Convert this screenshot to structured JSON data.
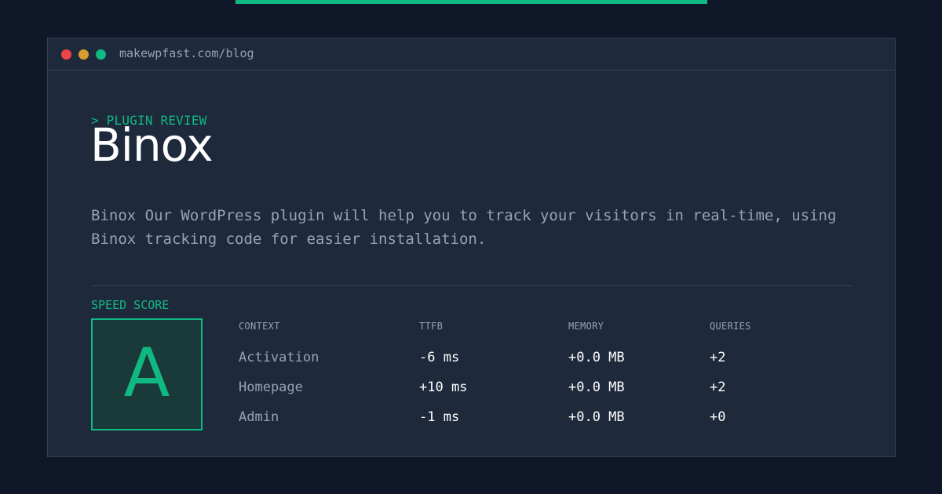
{
  "browser": {
    "url": "makewpfast.com/blog"
  },
  "post": {
    "eyebrow": "> PLUGIN REVIEW",
    "title": "Binox",
    "description": "Binox Our WordPress plugin will help you to track your visitors in real-time, using Binox tracking code for easier installation."
  },
  "speed": {
    "label": "SPEED SCORE",
    "grade": "A"
  },
  "table": {
    "headers": [
      "CONTEXT",
      "TTFB",
      "MEMORY",
      "QUERIES"
    ],
    "rows": [
      [
        "Activation",
        "-6 ms",
        "+0.0 MB",
        "+2"
      ],
      [
        "Homepage",
        "+10 ms",
        "+0.0 MB",
        "+2"
      ],
      [
        "Admin",
        "-1 ms",
        "+0.0 MB",
        "+0"
      ]
    ]
  },
  "colors": {
    "background": "#0f1729",
    "panel": "#1e293b",
    "accent": "#10b981",
    "muted_text": "#94a3b8",
    "window_close": "#ef4444",
    "window_minimize": "#d69e2e",
    "window_maximize": "#10b981"
  }
}
